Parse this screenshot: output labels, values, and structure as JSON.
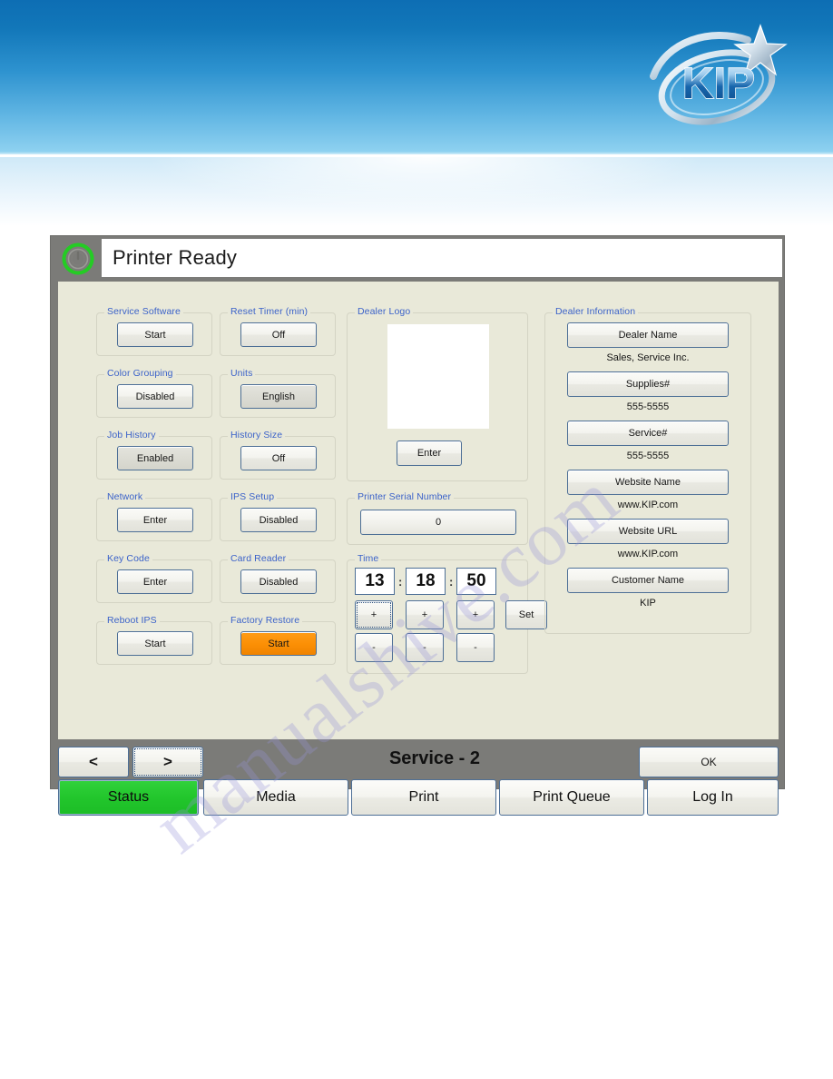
{
  "banner": {
    "logo_name": "kip-logo",
    "logo_text": "KIP",
    "sky_color_top": "#0d6eb4",
    "sky_color_bottom": "#8ed1f0"
  },
  "watermark": {
    "text": "manualshive.com",
    "color": "#9691d7"
  },
  "panel": {
    "frame_color": "#7b7b78",
    "content_color": "#e9e9d9",
    "status": {
      "icon": "power-icon",
      "icon_color": "#22cc22",
      "text": "Printer Ready"
    },
    "page_title": "Service - 2",
    "ok_button": "OK",
    "prev_button": "<",
    "next_button": ">"
  },
  "settings_groups": [
    {
      "label": "Service Software",
      "value": "Start",
      "pressed": false
    },
    {
      "label": "Reset Timer (min)",
      "value": "Off",
      "pressed": false
    },
    {
      "label": "Color Grouping",
      "value": "Disabled",
      "pressed": false
    },
    {
      "label": "Units",
      "value": "English",
      "pressed": true
    },
    {
      "label": "Job History",
      "value": "Enabled",
      "pressed": true
    },
    {
      "label": "History Size",
      "value": "Off",
      "pressed": false
    },
    {
      "label": "Network",
      "value": "Enter",
      "pressed": false
    },
    {
      "label": "IPS Setup",
      "value": "Disabled",
      "pressed": false
    },
    {
      "label": "Key Code",
      "value": "Enter",
      "pressed": false
    },
    {
      "label": "Card Reader",
      "value": "Disabled",
      "pressed": false
    },
    {
      "label": "Reboot IPS",
      "value": "Start",
      "pressed": false
    },
    {
      "label": "Factory Restore",
      "value": "Start",
      "pressed": false,
      "accent": "#f89406"
    }
  ],
  "dealer_logo": {
    "label": "Dealer Logo",
    "enter_button": "Enter",
    "preview_color": "#ffffff"
  },
  "printer_serial": {
    "label": "Printer Serial Number",
    "value": "0"
  },
  "time": {
    "label": "Time",
    "hours": "13",
    "minutes": "18",
    "seconds": "50",
    "separator": ":",
    "plus": "+",
    "minus": "-",
    "set_button": "Set"
  },
  "dealer_information": {
    "label": "Dealer Information",
    "rows": [
      {
        "button": "Dealer Name",
        "value": "Sales, Service Inc."
      },
      {
        "button": "Supplies#",
        "value": "555-5555"
      },
      {
        "button": "Service#",
        "value": "555-5555"
      },
      {
        "button": "Website Name",
        "value": "www.KIP.com"
      },
      {
        "button": "Website URL",
        "value": "www.KIP.com"
      },
      {
        "button": "Customer Name",
        "value": "KIP"
      }
    ]
  },
  "tabs": [
    {
      "label": "Status",
      "active": true
    },
    {
      "label": "Media",
      "active": false
    },
    {
      "label": "Print",
      "active": false
    },
    {
      "label": "Print Queue",
      "active": false
    },
    {
      "label": "Log In",
      "active": false
    }
  ]
}
